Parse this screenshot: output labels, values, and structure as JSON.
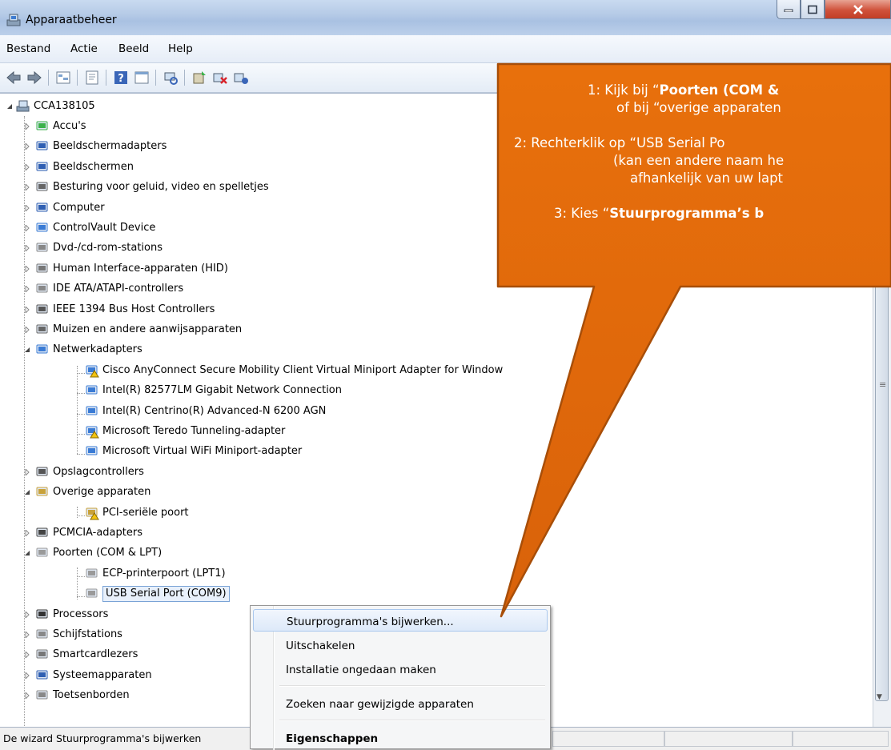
{
  "window": {
    "title": "Apparaatbeheer",
    "accent": "#e26b0a"
  },
  "menu": [
    "Bestand",
    "Actie",
    "Beeld",
    "Help"
  ],
  "tree": {
    "root": "CCA138105",
    "items": [
      {
        "label": "Accu's",
        "icon": "battery-icon"
      },
      {
        "label": "Beeldschermadapters",
        "icon": "display-adapter-icon"
      },
      {
        "label": "Beeldschermen",
        "icon": "monitor-icon"
      },
      {
        "label": "Besturing voor geluid, video en spelletjes",
        "icon": "speaker-icon"
      },
      {
        "label": "Computer",
        "icon": "computer-icon"
      },
      {
        "label": "ControlVault Device",
        "icon": "network-icon"
      },
      {
        "label": "Dvd-/cd-rom-stations",
        "icon": "dvd-icon"
      },
      {
        "label": "Human Interface-apparaten (HID)",
        "icon": "hid-icon"
      },
      {
        "label": "IDE ATA/ATAPI-controllers",
        "icon": "ide-icon"
      },
      {
        "label": "IEEE 1394 Bus Host Controllers",
        "icon": "firewire-icon"
      },
      {
        "label": "Muizen en andere aanwijsapparaten",
        "icon": "mouse-icon"
      },
      {
        "label": "Netwerkadapters",
        "icon": "network-icon",
        "expanded": true,
        "children": [
          {
            "label": "Cisco AnyConnect Secure Mobility Client Virtual Miniport Adapter for Window",
            "icon": "network-warn-icon"
          },
          {
            "label": "Intel(R) 82577LM Gigabit Network Connection",
            "icon": "network-icon"
          },
          {
            "label": "Intel(R) Centrino(R) Advanced-N 6200 AGN",
            "icon": "network-icon"
          },
          {
            "label": "Microsoft Teredo Tunneling-adapter",
            "icon": "network-warn-icon"
          },
          {
            "label": "Microsoft Virtual WiFi Miniport-adapter",
            "icon": "network-icon"
          }
        ]
      },
      {
        "label": "Opslagcontrollers",
        "icon": "storage-icon"
      },
      {
        "label": "Overige apparaten",
        "icon": "unknown-device-icon",
        "expanded": true,
        "children": [
          {
            "label": "PCI-seriële poort",
            "icon": "unknown-warn-icon"
          }
        ]
      },
      {
        "label": "PCMCIA-adapters",
        "icon": "pcmcia-icon"
      },
      {
        "label": "Poorten (COM & LPT)",
        "icon": "port-icon",
        "expanded": true,
        "children": [
          {
            "label": "ECP-printerpoort (LPT1)",
            "icon": "port-icon"
          },
          {
            "label": "USB Serial Port (COM9)",
            "icon": "port-icon",
            "selected": true
          }
        ]
      },
      {
        "label": "Processors",
        "icon": "cpu-icon"
      },
      {
        "label": "Schijfstations",
        "icon": "disk-icon"
      },
      {
        "label": "Smartcardlezers",
        "icon": "smartcard-icon"
      },
      {
        "label": "Systeemapparaten",
        "icon": "computer-icon"
      },
      {
        "label": "Toetsenborden",
        "icon": "keyboard-icon"
      }
    ]
  },
  "context_menu": [
    "Stuurprogramma's bijwerken...",
    "Uitschakelen",
    "Installatie ongedaan maken",
    "Zoeken naar gewijzigde apparaten",
    "Eigenschappen"
  ],
  "status": {
    "text": "De wizard Stuurprogramma's bijwerken"
  },
  "callout": {
    "l1a": "1: Kijk bij “",
    "l1b": "Poorten (COM &",
    "l2": "of bij “overige apparaten",
    "l3": "2: Rechterklik op “USB Serial Po",
    "l4": "(kan een andere naam he",
    "l5": "afhankelijk van uw lapt",
    "l6a": "3: Kies “",
    "l6b": "Stuurprogramma’s b"
  }
}
